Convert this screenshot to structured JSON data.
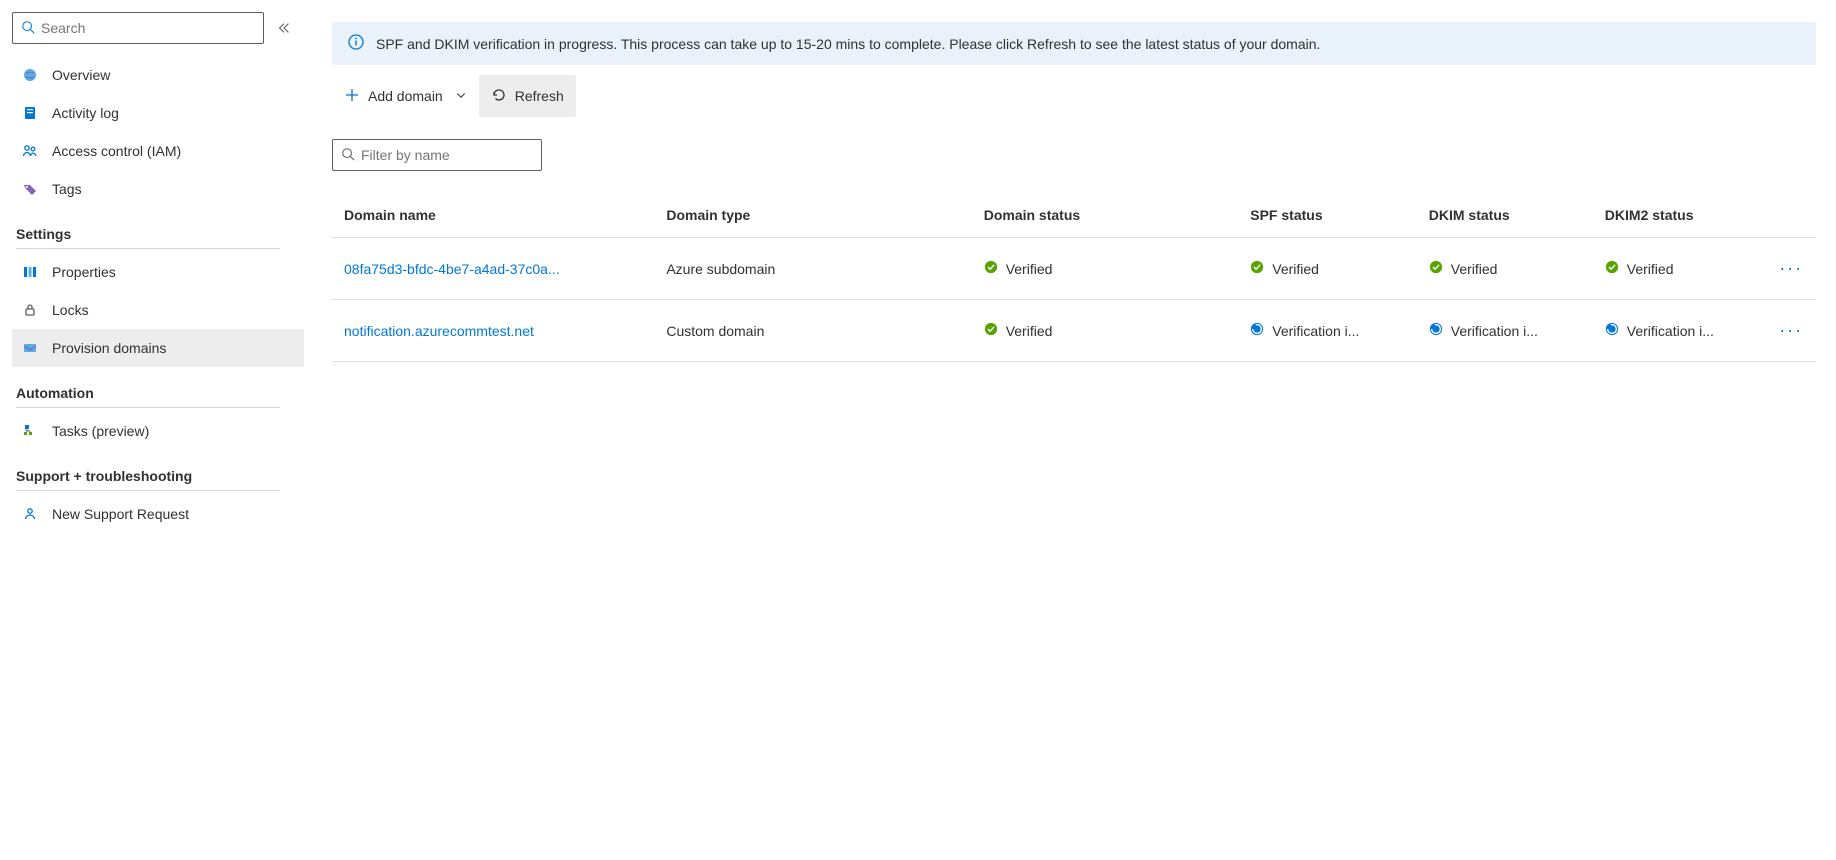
{
  "sidebar": {
    "search_placeholder": "Search",
    "items_top": [
      {
        "label": "Overview",
        "icon": "globe-icon"
      },
      {
        "label": "Activity log",
        "icon": "book-icon"
      },
      {
        "label": "Access control (IAM)",
        "icon": "people-icon"
      },
      {
        "label": "Tags",
        "icon": "tag-icon"
      }
    ],
    "group_settings": {
      "title": "Settings",
      "items": [
        {
          "label": "Properties",
          "icon": "properties-icon"
        },
        {
          "label": "Locks",
          "icon": "lock-icon"
        },
        {
          "label": "Provision domains",
          "icon": "domains-icon",
          "selected": true
        }
      ]
    },
    "group_automation": {
      "title": "Automation",
      "items": [
        {
          "label": "Tasks (preview)",
          "icon": "tasks-icon"
        }
      ]
    },
    "group_support": {
      "title": "Support + troubleshooting",
      "items": [
        {
          "label": "New Support Request",
          "icon": "support-icon"
        }
      ]
    }
  },
  "banner": {
    "text": "SPF and DKIM verification in progress. This process can take up to 15-20 mins to complete. Please click Refresh to see the latest status of your domain."
  },
  "toolbar": {
    "add_domain_label": "Add domain",
    "refresh_label": "Refresh"
  },
  "filter": {
    "placeholder": "Filter by name"
  },
  "columns": {
    "name": "Domain name",
    "type": "Domain type",
    "dstatus": "Domain status",
    "spf": "SPF status",
    "dkim": "DKIM status",
    "dkim2": "DKIM2 status"
  },
  "rows": [
    {
      "name": "08fa75d3-bfdc-4be7-a4ad-37c0a...",
      "type": "Azure subdomain",
      "dstatus": {
        "text": "Verified",
        "state": "verified"
      },
      "spf": {
        "text": "Verified",
        "state": "verified"
      },
      "dkim": {
        "text": "Verified",
        "state": "verified"
      },
      "dkim2": {
        "text": "Verified",
        "state": "verified"
      }
    },
    {
      "name": "notification.azurecommtest.net",
      "type": "Custom domain",
      "dstatus": {
        "text": "Verified",
        "state": "verified"
      },
      "spf": {
        "text": "Verification i...",
        "state": "inprogress"
      },
      "dkim": {
        "text": "Verification i...",
        "state": "inprogress"
      },
      "dkim2": {
        "text": "Verification i...",
        "state": "inprogress"
      }
    }
  ]
}
